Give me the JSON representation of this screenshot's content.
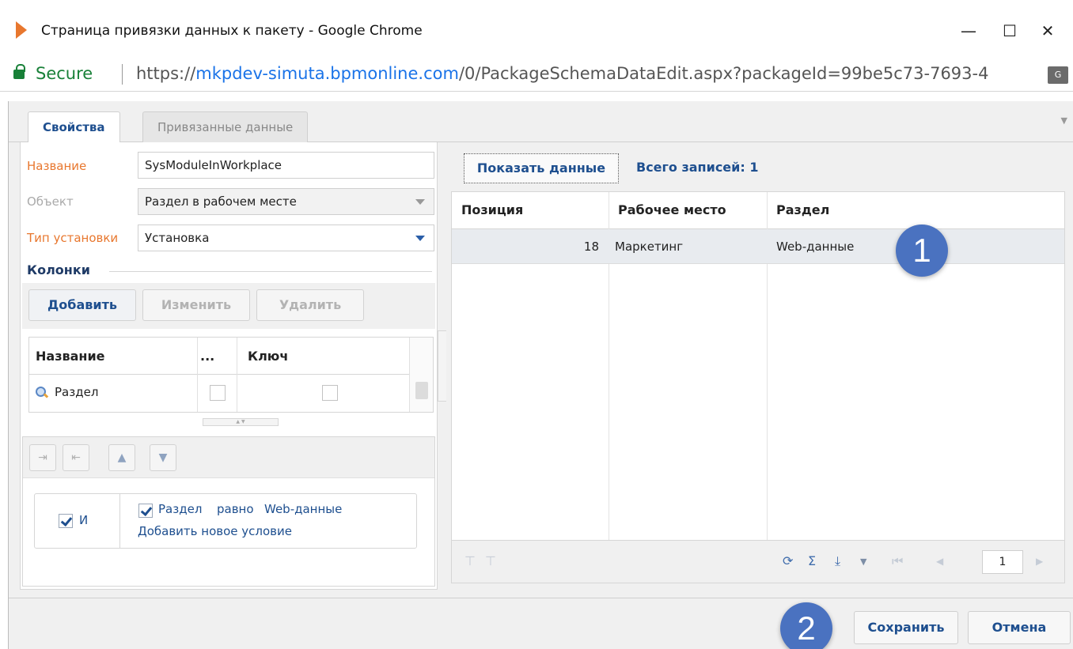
{
  "window": {
    "title": "Страница привязки данных к пакету - Google Chrome",
    "minimize_glyph": "—",
    "maximize_glyph": "☐",
    "close_glyph": "✕",
    "icon": "play-triangle-icon",
    "accent_color": "#e8772e"
  },
  "address": {
    "secure_label": "Secure",
    "url_scheme": "https://",
    "url_host": "mkpdev-simuta.bpmonline.com",
    "url_path": "/0/PackageSchemaDataEdit.aspx?packageId=99be5c73-7693-4",
    "translate_icon": "translate-icon"
  },
  "tabs": [
    {
      "label": "Свойства",
      "active": true
    },
    {
      "label": "Привязанные данные",
      "active": false
    }
  ],
  "properties": {
    "name_label": "Название",
    "name_value": "SysModuleInWorkplace",
    "object_label": "Объект",
    "object_value": "Раздел в рабочем месте",
    "install_type_label": "Тип установки",
    "install_type_value": "Установка"
  },
  "columns": {
    "group_title": "Колонки",
    "add_label": "Добавить",
    "edit_label": "Изменить",
    "delete_label": "Удалить",
    "headers": [
      "Название",
      "...",
      "Ключ"
    ],
    "rows": [
      {
        "name": "Раздел",
        "flag": false,
        "key": false
      }
    ]
  },
  "filter": {
    "group_operator": "И",
    "condition_column": "Раздел",
    "condition_operator": "равно",
    "condition_value": "Web-данные",
    "add_condition_label": "Добавить новое условие"
  },
  "data_panel": {
    "show_data_label": "Показать данные",
    "total_label": "Всего записей: 1",
    "headers": [
      "Позиция",
      "Рабочее место",
      "Раздел"
    ],
    "rows": [
      {
        "position": "18",
        "workplace": "Маркетинг",
        "section": "Web-данные"
      }
    ],
    "page_number": "1"
  },
  "buttons": {
    "save_label": "Сохранить",
    "cancel_label": "Отмена"
  },
  "callouts": {
    "first": "1",
    "second": "2",
    "color": "#4a72c0"
  }
}
